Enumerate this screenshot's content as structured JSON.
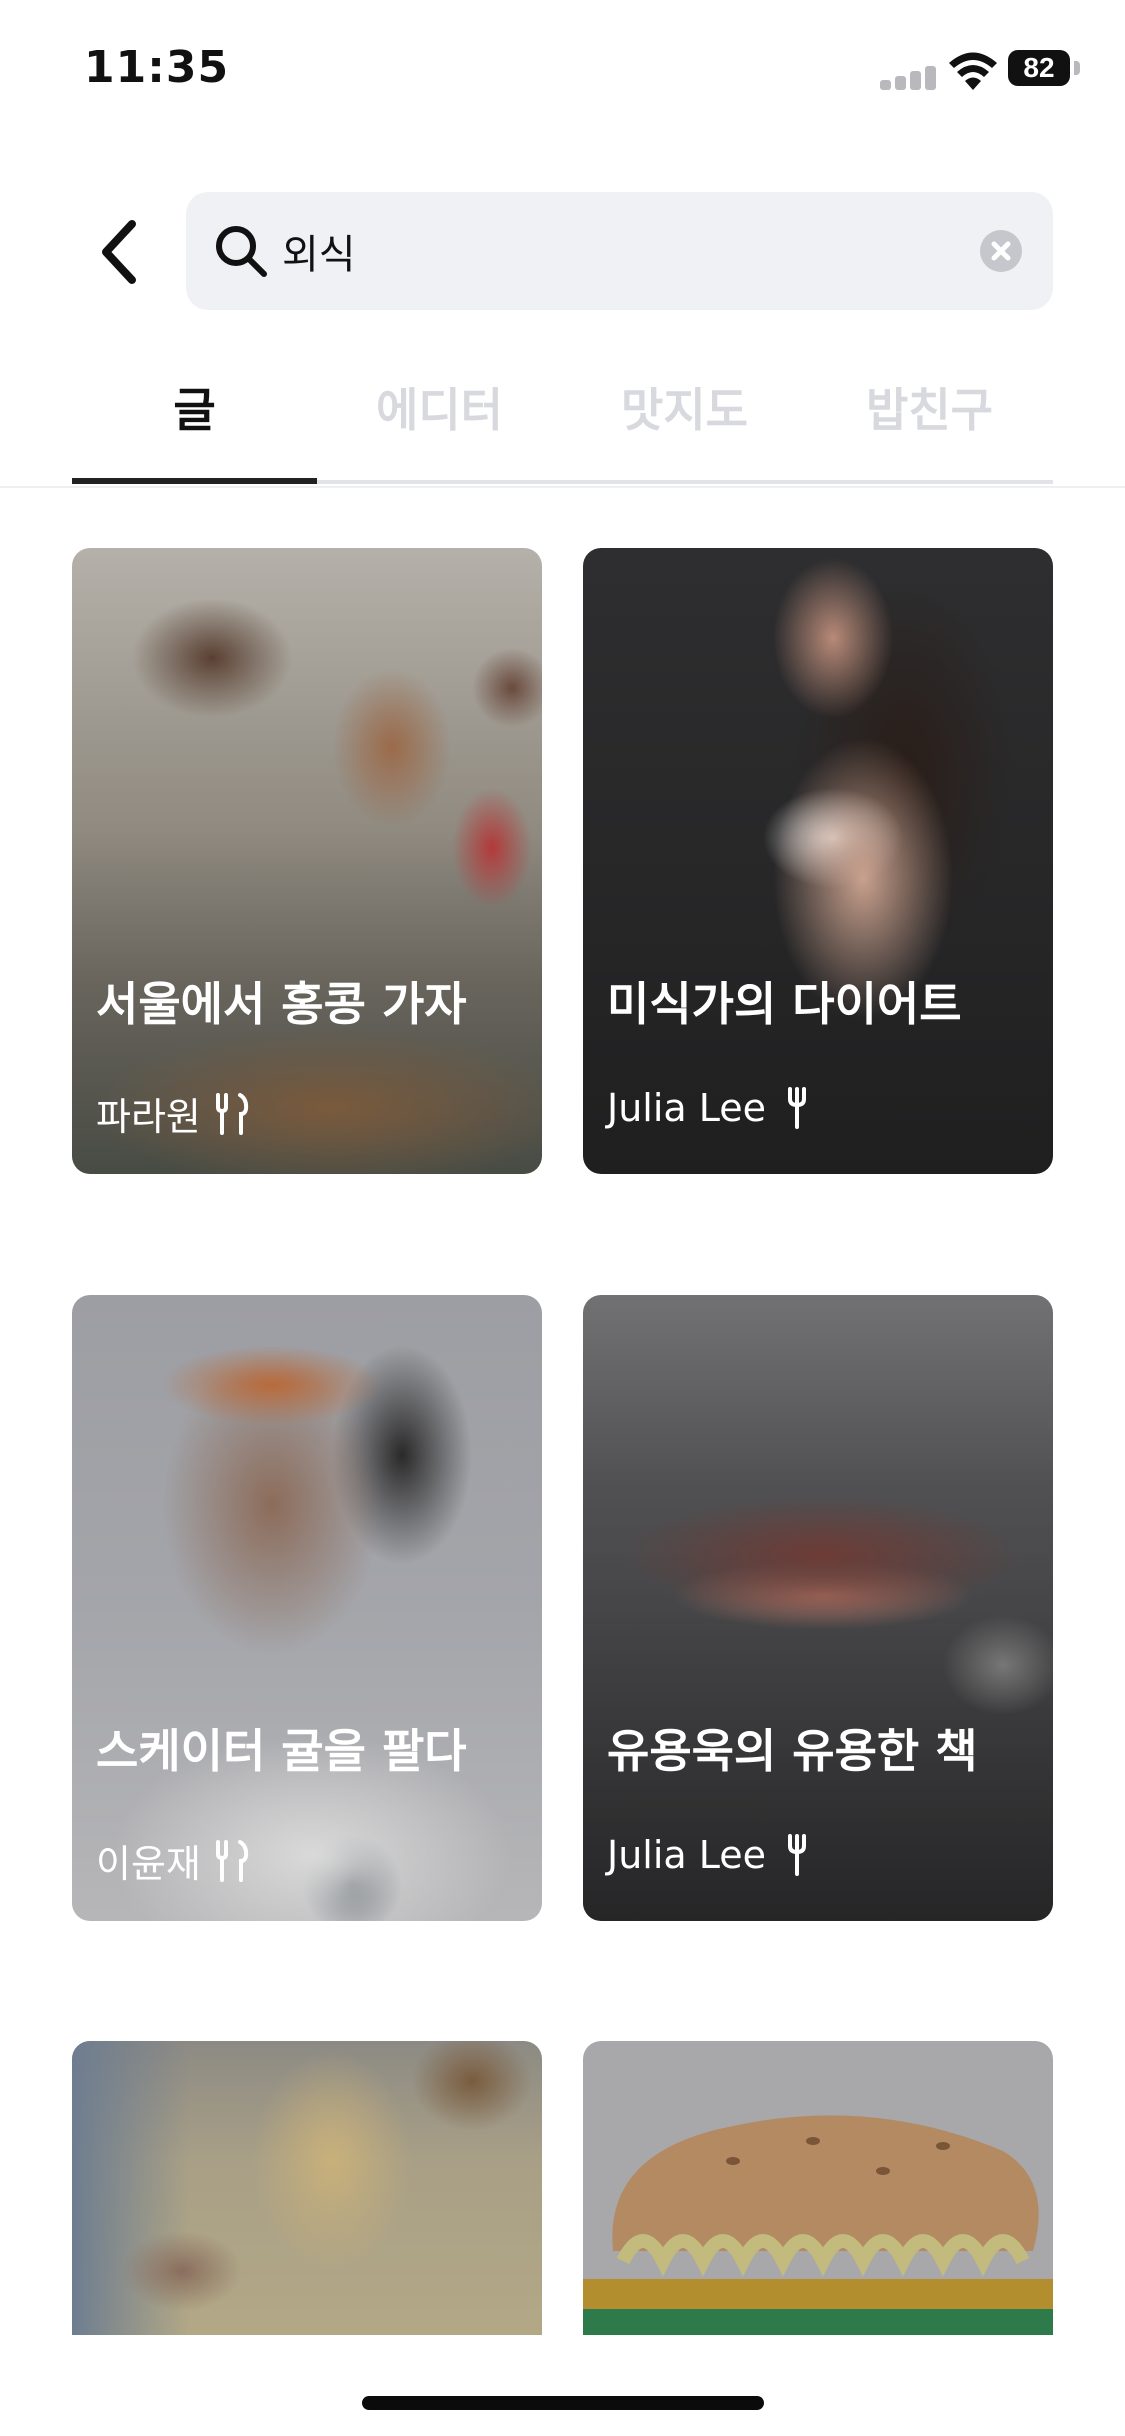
{
  "status_bar": {
    "time": "11:35",
    "battery": "82"
  },
  "search": {
    "query": "외식"
  },
  "tabs": [
    {
      "label": "글",
      "active": true
    },
    {
      "label": "에디터",
      "active": false
    },
    {
      "label": "맛지도",
      "active": false
    },
    {
      "label": "밥친구",
      "active": false
    }
  ],
  "cards": [
    {
      "title": "서울에서 홍콩 가자",
      "author": "파라원",
      "icon": "fork-knife-icon"
    },
    {
      "title": "미식가의 다이어트",
      "author": "Julia Lee",
      "icon": "fork-icon"
    },
    {
      "title": "스케이터 귤을 팔다",
      "author": "이윤재",
      "icon": "fork-knife-icon"
    },
    {
      "title": "유용욱의 유용한 책",
      "author": "Julia Lee",
      "icon": "fork-icon"
    },
    {
      "title": "",
      "author": ""
    },
    {
      "title": "",
      "author": ""
    }
  ],
  "colors": {
    "active_tab": "#111111",
    "inactive_tab": "#d7d9de",
    "search_bg": "#f0f1f4"
  }
}
